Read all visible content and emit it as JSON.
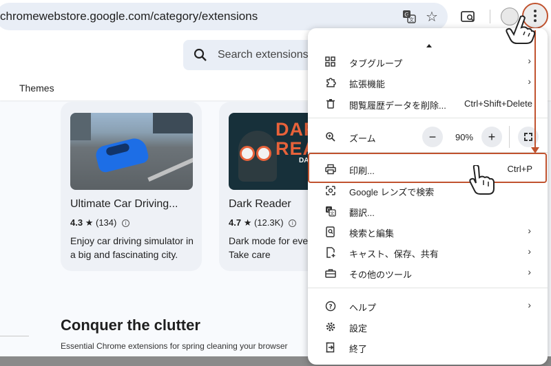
{
  "browser": {
    "url": "chromewebstore.google.com/category/extensions"
  },
  "page": {
    "search_placeholder": "Search extensions",
    "tab_themes": "Themes",
    "cards": [
      {
        "title": "Ultimate Car Driving...",
        "rating": "4.3",
        "reviews": "(134)",
        "description": "Enjoy car driving simulator in a big and fascinating city."
      },
      {
        "title": "Dark Reader",
        "rating": "4.7",
        "reviews": "(12.3K)",
        "description": "Dark mode for every website. Take care",
        "thumb_title": "DARK READER",
        "thumb_sub": "DA FOR"
      }
    ],
    "section_title": "Conquer the clutter",
    "section_subtitle": "Essential Chrome extensions for spring cleaning your browser"
  },
  "menu": {
    "items": [
      {
        "label": "タブグループ",
        "icon": "tab-group-icon",
        "has_submenu": true
      },
      {
        "label": "拡張機能",
        "icon": "extension-icon",
        "has_submenu": true
      },
      {
        "label": "閲覧履歴データを削除...",
        "icon": "trash-icon",
        "shortcut": "Ctrl+Shift+Delete"
      },
      {
        "label": "ズーム",
        "icon": "zoom-icon"
      },
      {
        "label": "印刷...",
        "icon": "print-icon",
        "shortcut": "Ctrl+P"
      },
      {
        "label": "Google レンズで検索",
        "icon": "lens-icon"
      },
      {
        "label": "翻訳...",
        "icon": "translate-icon"
      },
      {
        "label": "検索と編集",
        "icon": "search-edit-icon",
        "has_submenu": true
      },
      {
        "label": "キャスト、保存、共有",
        "icon": "cast-save-icon",
        "has_submenu": true
      },
      {
        "label": "その他のツール",
        "icon": "toolbox-icon",
        "has_submenu": true
      },
      {
        "label": "ヘルプ",
        "icon": "help-icon",
        "has_submenu": true
      },
      {
        "label": "設定",
        "icon": "settings-icon"
      },
      {
        "label": "終了",
        "icon": "exit-icon"
      }
    ],
    "zoom": {
      "minus": "−",
      "value": "90%",
      "plus": "+"
    }
  },
  "colors": {
    "highlight": "#c0522e",
    "omnibox": "#e9eef6",
    "card_bg": "#eef1f6"
  }
}
